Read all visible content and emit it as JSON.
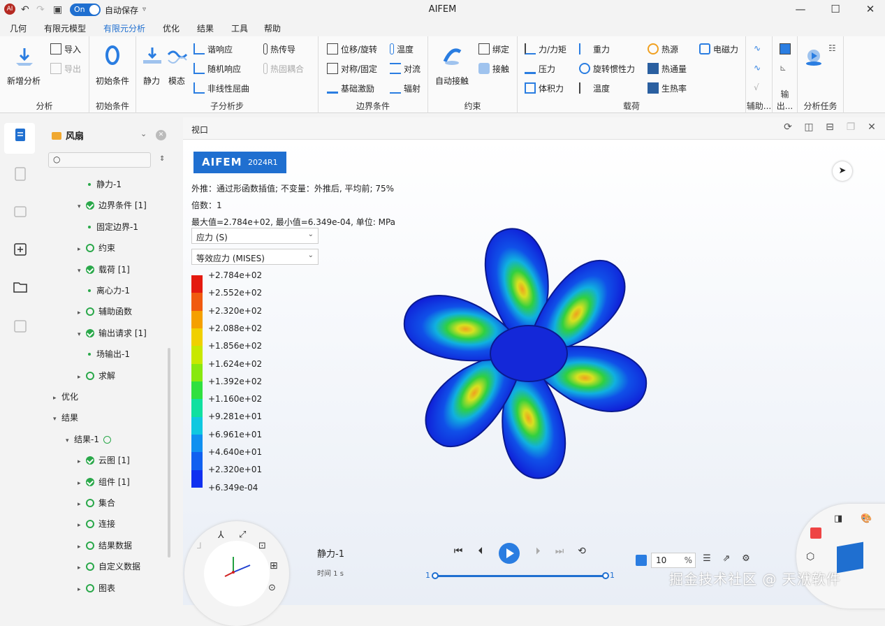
{
  "window": {
    "title": "AIFEM",
    "autosave_toggle": "On",
    "autosave_label": "自动保存",
    "app_icon": "AI"
  },
  "menu": [
    "几何",
    "有限元模型",
    "有限元分析",
    "优化",
    "结果",
    "工具",
    "帮助"
  ],
  "ribbon": {
    "analysis": {
      "label": "分析",
      "new": "新增分析",
      "import": "导入",
      "export": "导出"
    },
    "initial": {
      "label": "初始条件",
      "btn": "初始条件"
    },
    "substep": {
      "label": "子分析步",
      "static": "静力",
      "modal": "模态",
      "harmonic": "谐响应",
      "random": "随机响应",
      "buckling": "非线性屈曲",
      "heat": "热传导",
      "thermo": "热固耦合"
    },
    "boundary": {
      "label": "边界条件",
      "disp": "位移/旋转",
      "sym": "对称/固定",
      "base": "基础激励",
      "temp": "温度",
      "conv": "对流",
      "rad": "辐射"
    },
    "constraint": {
      "label": "约束",
      "auto": "自动接触",
      "tie": "绑定",
      "contact": "接触"
    },
    "load": {
      "label": "载荷",
      "force": "力/力矩",
      "pressure": "压力",
      "body": "体积力",
      "gravity": "重力",
      "rot": "旋转惯性力",
      "temp": "温度",
      "heat": "热源",
      "flux": "热通量",
      "gen": "生热率",
      "em": "电磁力"
    },
    "aux": {
      "label": "辅助..."
    },
    "output": {
      "label": "输出..."
    },
    "task": {
      "label": "分析任务"
    }
  },
  "tree": {
    "root": "风扇",
    "search_placeholder": "",
    "nodes": [
      {
        "text": "静力-1",
        "kind": "dot",
        "indent": 2
      },
      {
        "text": "边界条件 [1]",
        "kind": "chk",
        "indent": 1,
        "open": true
      },
      {
        "text": "固定边界-1",
        "kind": "dot",
        "indent": 2
      },
      {
        "text": "约束",
        "kind": "ring",
        "indent": 1
      },
      {
        "text": "载荷 [1]",
        "kind": "chk",
        "indent": 1,
        "open": true
      },
      {
        "text": "离心力-1",
        "kind": "dot",
        "indent": 2
      },
      {
        "text": "辅助函数",
        "kind": "ring",
        "indent": 1
      },
      {
        "text": "输出请求 [1]",
        "kind": "chk",
        "indent": 1,
        "open": true
      },
      {
        "text": "场输出-1",
        "kind": "dot",
        "indent": 2
      },
      {
        "text": "求解",
        "kind": "play",
        "indent": 1
      },
      {
        "text": "优化",
        "kind": "none",
        "indent": -1
      },
      {
        "text": "结果",
        "kind": "none",
        "indent": -1,
        "open": true
      },
      {
        "text": "结果-1",
        "kind": "after",
        "indent": 0,
        "open": true
      },
      {
        "text": "云图 [1]",
        "kind": "chk",
        "indent": 1
      },
      {
        "text": "组件 [1]",
        "kind": "chk",
        "indent": 1
      },
      {
        "text": "集合",
        "kind": "ring",
        "indent": 1
      },
      {
        "text": "连接",
        "kind": "ring",
        "indent": 1
      },
      {
        "text": "结果数据",
        "kind": "ring",
        "indent": 1
      },
      {
        "text": "自定义数据",
        "kind": "ring",
        "indent": 1
      },
      {
        "text": "图表",
        "kind": "ring",
        "indent": 1
      }
    ]
  },
  "viewport": {
    "tab": "视口",
    "logo_main": "AIFEM",
    "logo_ver": "2024R1",
    "extrapolation": "外推：通过形函数插值; 不变量：外推后, 平均前; 75%",
    "scale": "倍数：1",
    "range": "最大值=2.784e+02, 最小值=6.349e-04, 单位: MPa",
    "variable": "应力 (S)",
    "component": "等效应力 (MISES)",
    "legend": [
      "+2.784e+02",
      "+2.552e+02",
      "+2.320e+02",
      "+2.088e+02",
      "+1.856e+02",
      "+1.624e+02",
      "+1.392e+02",
      "+1.160e+02",
      "+9.281e+01",
      "+6.961e+01",
      "+4.640e+01",
      "+2.320e+01",
      "+6.349e-04"
    ],
    "legend_colors": [
      "#e41a10",
      "#f05a10",
      "#f5a000",
      "#f0d000",
      "#c8e800",
      "#88e810",
      "#30e040",
      "#10e0a0",
      "#10c8e0",
      "#1090f0",
      "#1060f0",
      "#1030f0",
      "#1010e8"
    ],
    "step_name": "静力-1",
    "time": "时间 1 s",
    "slider_start": "1",
    "slider_end": "1",
    "zoom_value": "10",
    "zoom_unit": "%",
    "watermark": "掘金技术社区 @ 天洑软件"
  }
}
